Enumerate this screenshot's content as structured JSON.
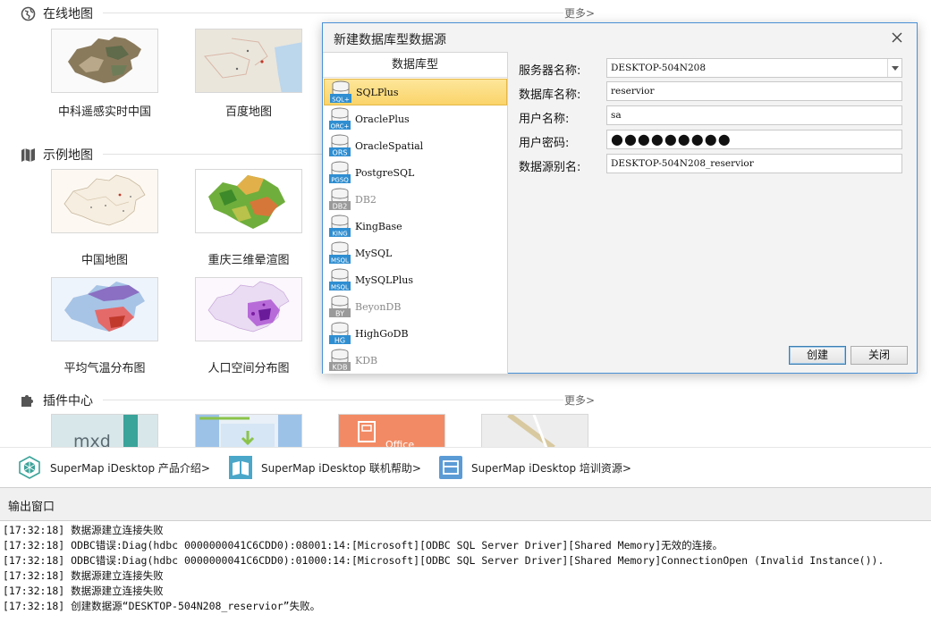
{
  "start_page": {
    "online_maps": {
      "title": "在线地图",
      "more": "更多>"
    },
    "online_items": [
      {
        "label": "中科遥感实时中国"
      },
      {
        "label": "百度地图"
      }
    ],
    "sample_maps": {
      "title": "示例地图"
    },
    "sample_items": [
      {
        "label": "中国地图"
      },
      {
        "label": "重庆三维晕渲图"
      },
      {
        "label": "平均气温分布图"
      },
      {
        "label": "人口空间分布图"
      }
    ],
    "plugins": {
      "title": "插件中心",
      "more": "更多>"
    },
    "plugin_thumb_texts": {
      "mxd": "mxd",
      "office": "Office"
    }
  },
  "resources": [
    {
      "label": "SuperMap iDesktop 产品介绍>",
      "icon": "product-intro-icon"
    },
    {
      "label": "SuperMap iDesktop 联机帮助>",
      "icon": "online-help-icon"
    },
    {
      "label": "SuperMap iDesktop 培训资源>",
      "icon": "training-resource-icon"
    }
  ],
  "dialog": {
    "title": "新建数据库型数据源",
    "db_type_header": "数据库型",
    "db_types": [
      {
        "name": "SQLPlus",
        "badge": "SQL+",
        "enabled": true,
        "selected": true
      },
      {
        "name": "OraclePlus",
        "badge": "ORC+",
        "enabled": true,
        "selected": false
      },
      {
        "name": "OracleSpatial",
        "badge": "ORS",
        "enabled": true,
        "selected": false
      },
      {
        "name": "PostgreSQL",
        "badge": "PGSQ",
        "enabled": true,
        "selected": false
      },
      {
        "name": "DB2",
        "badge": "DB2",
        "enabled": false,
        "selected": false
      },
      {
        "name": "KingBase",
        "badge": "KING",
        "enabled": true,
        "selected": false
      },
      {
        "name": "MySQL",
        "badge": "MSQL",
        "enabled": true,
        "selected": false
      },
      {
        "name": "MySQLPlus",
        "badge": "MSQL",
        "enabled": true,
        "selected": false
      },
      {
        "name": "BeyonDB",
        "badge": "BY",
        "enabled": false,
        "selected": false
      },
      {
        "name": "HighGoDB",
        "badge": "HG",
        "enabled": true,
        "selected": false
      },
      {
        "name": "KDB",
        "badge": "KDB",
        "enabled": false,
        "selected": false
      }
    ],
    "fields": {
      "server_label": "服务器名称:",
      "server_value": "DESKTOP-504N208",
      "database_label": "数据库名称:",
      "database_value": "reservior",
      "user_label": "用户名称:",
      "user_value": "sa",
      "password_label": "用户密码:",
      "password_mask": "●●●●●●●●●",
      "alias_label": "数据源别名:",
      "alias_value": "DESKTOP-504N208_reservior"
    },
    "create_button": "创建",
    "close_button": "关闭"
  },
  "output": {
    "title": "输出窗口",
    "lines": [
      "[17:32:18] 数据源建立连接失败",
      "[17:32:18] ODBC错误:Diag(hdbc 0000000041C6CDD0):08001:14:[Microsoft][ODBC SQL Server Driver][Shared Memory]无效的连接。",
      "[17:32:18] ODBC错误:Diag(hdbc 0000000041C6CDD0):01000:14:[Microsoft][ODBC SQL Server Driver][Shared Memory]ConnectionOpen (Invalid Instance()).",
      "[17:32:18] 数据源建立连接失败",
      "[17:32:18] 数据源建立连接失败",
      "[17:32:18] 创建数据源“DESKTOP-504N208_reservior”失败。"
    ]
  },
  "colors": {
    "accent_border": "#4a90d6",
    "selected_item": "#fbd46a",
    "db_icon_blue": "#2f8ed1",
    "db_icon_gray": "#9a9a9a"
  }
}
